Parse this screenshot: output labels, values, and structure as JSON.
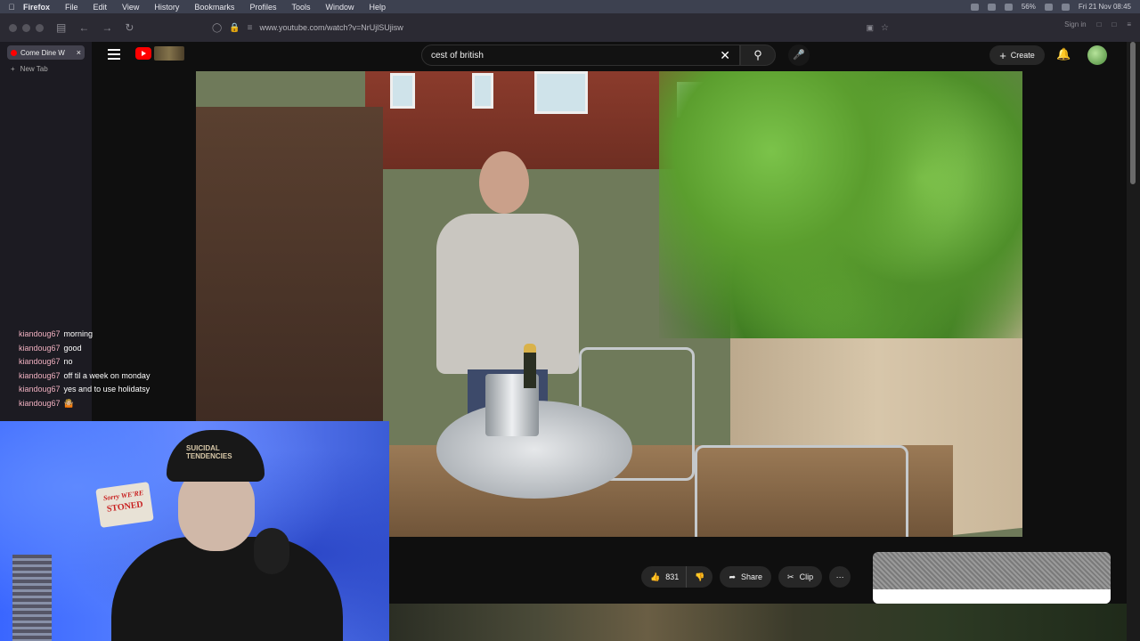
{
  "menubar": {
    "app": "Firefox",
    "items": [
      "File",
      "Edit",
      "View",
      "History",
      "Bookmarks",
      "Profiles",
      "Tools",
      "Window",
      "Help"
    ],
    "battery": "56%",
    "clock": "Fri 21 Nov 08:45"
  },
  "browser": {
    "url": "www.youtube.com/watch?v=NrUjlSUjisw",
    "sign_in": "Sign in",
    "tabs": [
      {
        "title": "Come Dine W"
      }
    ],
    "new_tab": "New Tab"
  },
  "youtube": {
    "search_value": "cest of british",
    "create_label": "Create",
    "likes": "831",
    "share_label": "Share",
    "clip_label": "Clip"
  },
  "chat": {
    "messages": [
      {
        "user": "kiandoug67",
        "text": "morning"
      },
      {
        "user": "kiandoug67",
        "text": "good"
      },
      {
        "user": "kiandoug67",
        "text": "no"
      },
      {
        "user": "kiandoug67",
        "text": "off til a week on monday"
      },
      {
        "user": "kiandoug67",
        "text": "yes and to use holidatsy"
      },
      {
        "user": "kiandoug67",
        "text": "🤷🏼"
      }
    ]
  },
  "webcam": {
    "sign_text_1": "Sorry WE'RE",
    "sign_text_2": "STONED",
    "cap_text": "SUICIDAL TENDENCIES"
  },
  "colors": {
    "yt_red": "#ff0000",
    "bg": "#0f0f0f",
    "chat_user": "#f0b0c0"
  }
}
